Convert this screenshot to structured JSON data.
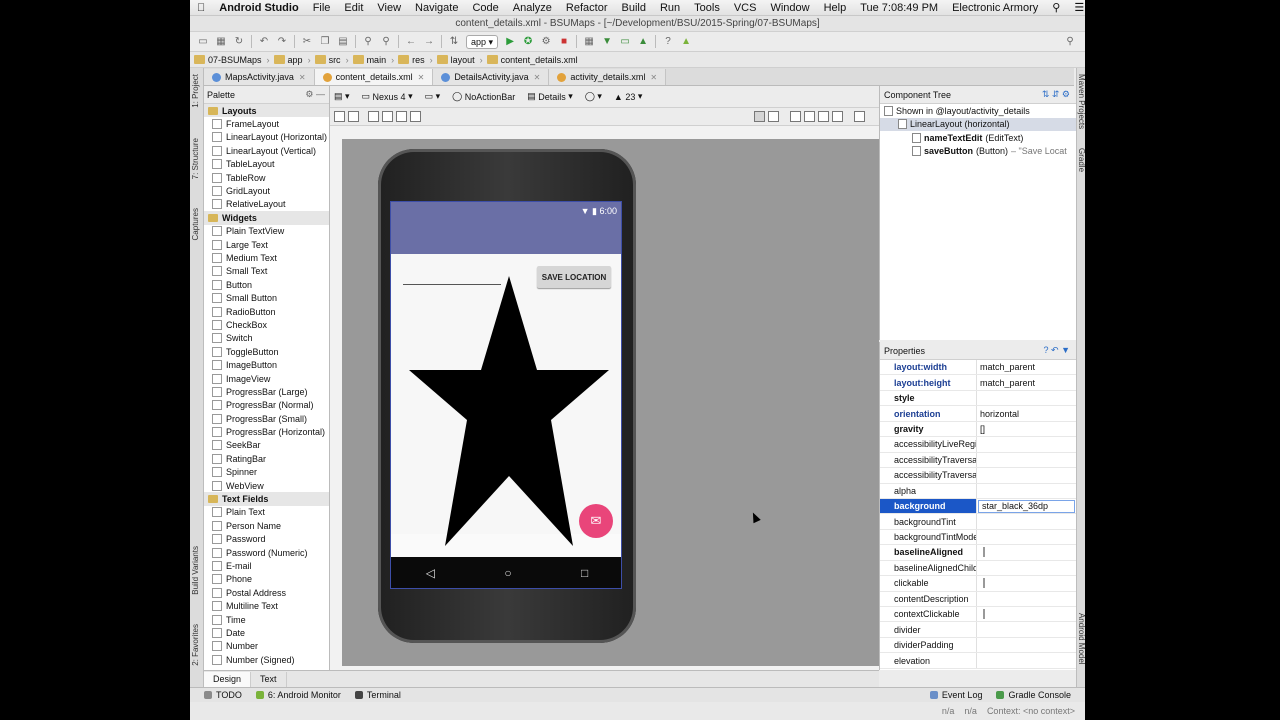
{
  "menubar": {
    "app": "Android Studio",
    "items": [
      "File",
      "Edit",
      "View",
      "Navigate",
      "Code",
      "Analyze",
      "Refactor",
      "Build",
      "Run",
      "Tools",
      "VCS",
      "Window",
      "Help"
    ],
    "clock": "Tue 7:08:49 PM",
    "user": "Electronic Armory"
  },
  "window_title": "content_details.xml - BSUMaps - [~/Development/BSU/2015-Spring/07-BSUMaps]",
  "toolbar": {
    "run_config": "app"
  },
  "breadcrumb": [
    "07-BSUMaps",
    "app",
    "src",
    "main",
    "res",
    "layout",
    "content_details.xml"
  ],
  "tabs": [
    {
      "label": "MapsActivity.java",
      "color": "#5b8fd8"
    },
    {
      "label": "content_details.xml",
      "color": "#e2a23b",
      "active": true
    },
    {
      "label": "DetailsActivity.java",
      "color": "#5b8fd8"
    },
    {
      "label": "activity_details.xml",
      "color": "#e2a23b"
    }
  ],
  "left_strip": [
    "1: Project",
    "7: Structure",
    "Captures",
    "Build Variants",
    "2: Favorites"
  ],
  "right_strip": [
    "Maven Projects",
    "Gradle",
    "Android Model"
  ],
  "palette": {
    "title": "Palette",
    "groups": [
      {
        "name": "Layouts",
        "items": [
          "FrameLayout",
          "LinearLayout (Horizontal)",
          "LinearLayout (Vertical)",
          "TableLayout",
          "TableRow",
          "GridLayout",
          "RelativeLayout"
        ]
      },
      {
        "name": "Widgets",
        "items": [
          "Plain TextView",
          "Large Text",
          "Medium Text",
          "Small Text",
          "Button",
          "Small Button",
          "RadioButton",
          "CheckBox",
          "Switch",
          "ToggleButton",
          "ImageButton",
          "ImageView",
          "ProgressBar (Large)",
          "ProgressBar (Normal)",
          "ProgressBar (Small)",
          "ProgressBar (Horizontal)",
          "SeekBar",
          "RatingBar",
          "Spinner",
          "WebView"
        ]
      },
      {
        "name": "Text Fields",
        "items": [
          "Plain Text",
          "Person Name",
          "Password",
          "Password (Numeric)",
          "E-mail",
          "Phone",
          "Postal Address",
          "Multiline Text",
          "Time",
          "Date",
          "Number",
          "Number (Signed)"
        ]
      }
    ]
  },
  "designer": {
    "device": "Nexus 4",
    "theme": "NoActionBar",
    "activity": "Details",
    "api": "23"
  },
  "phone": {
    "time": "6:00",
    "button": "SAVE LOCATION"
  },
  "bottom_tabs": [
    "Design",
    "Text"
  ],
  "component_tree": {
    "title": "Component Tree",
    "nodes": [
      {
        "label": "Shown in @layout/activity_details",
        "level": 0
      },
      {
        "label": "LinearLayout (horizontal)",
        "level": 1,
        "sel": true
      },
      {
        "name": "nameTextEdit",
        "type": "(EditText)",
        "level": 2
      },
      {
        "name": "saveButton",
        "type": "(Button)",
        "extra": "– \"Save Locat",
        "level": 2
      }
    ]
  },
  "properties": {
    "title": "Properties",
    "rows": [
      {
        "name": "layout:width",
        "value": "match_parent",
        "style": "blue"
      },
      {
        "name": "layout:height",
        "value": "match_parent",
        "style": "blue"
      },
      {
        "name": "style",
        "value": "",
        "style": "bold"
      },
      {
        "name": "orientation",
        "value": "horizontal",
        "style": "blue"
      },
      {
        "name": "gravity",
        "value": "[]",
        "style": "bold",
        "expand": true
      },
      {
        "name": "accessibilityLiveRegion",
        "value": ""
      },
      {
        "name": "accessibilityTraversalAfter",
        "value": ""
      },
      {
        "name": "accessibilityTraversalBefore",
        "value": ""
      },
      {
        "name": "alpha",
        "value": ""
      },
      {
        "name": "background",
        "value": "star_black_36dp",
        "sel": true
      },
      {
        "name": "backgroundTint",
        "value": ""
      },
      {
        "name": "backgroundTintMode",
        "value": ""
      },
      {
        "name": "baselineAligned",
        "value": "",
        "style": "bold",
        "check": true
      },
      {
        "name": "baselineAlignedChildIndex",
        "value": ""
      },
      {
        "name": "clickable",
        "value": "",
        "check": true
      },
      {
        "name": "contentDescription",
        "value": ""
      },
      {
        "name": "contextClickable",
        "value": "",
        "check": true
      },
      {
        "name": "divider",
        "value": ""
      },
      {
        "name": "dividerPadding",
        "value": ""
      },
      {
        "name": "elevation",
        "value": ""
      }
    ]
  },
  "statusbar": {
    "left": [
      "TODO",
      "6: Android Monitor",
      "Terminal"
    ],
    "right": [
      "Event Log",
      "Gradle Console"
    ]
  },
  "bottom_status": {
    "a": "n/a",
    "b": "n/a",
    "context": "Context: <no context>"
  }
}
